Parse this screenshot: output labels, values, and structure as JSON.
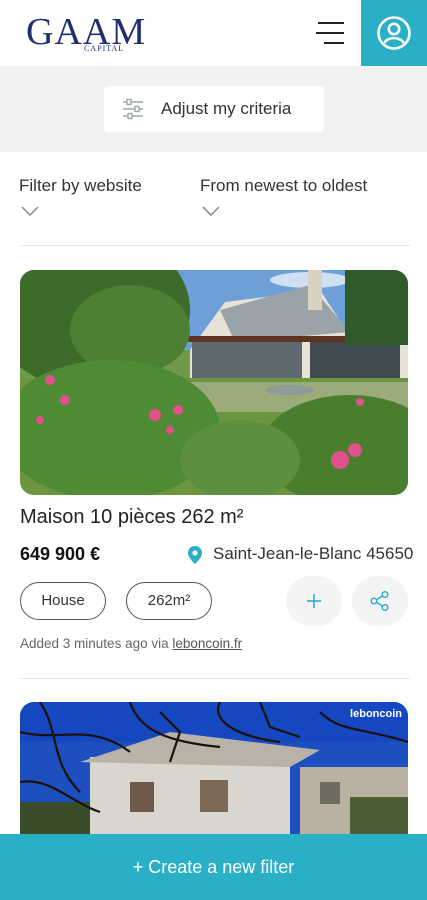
{
  "header": {
    "logo_main": "GAAM",
    "logo_sub": "CAPITAL"
  },
  "criteria": {
    "label": "Adjust my criteria"
  },
  "filters": {
    "website_label": "Filter by website",
    "sort_label": "From newest to oldest"
  },
  "listings": [
    {
      "title": "Maison 10 pièces 262 m²",
      "price": "649 900 €",
      "location": "Saint-Jean-le-Blanc 45650",
      "tags": [
        "House",
        "262m²"
      ],
      "added_text": "Added 3 minutes ago via ",
      "source": "leboncoin.fr"
    },
    {
      "watermark": "leboncoin"
    }
  ],
  "footer": {
    "create_label": "+ Create a new filter"
  },
  "colors": {
    "accent": "#2ab0c6",
    "brand": "#1d2f6f",
    "band": "#f2f2f2"
  },
  "icons": {
    "menu": "hamburger-icon",
    "profile": "user-circle-icon",
    "criteria": "sliders-icon",
    "dropdown": "chevron-down-icon",
    "location": "map-pin-icon",
    "add": "plus-icon",
    "share": "share-icon"
  }
}
